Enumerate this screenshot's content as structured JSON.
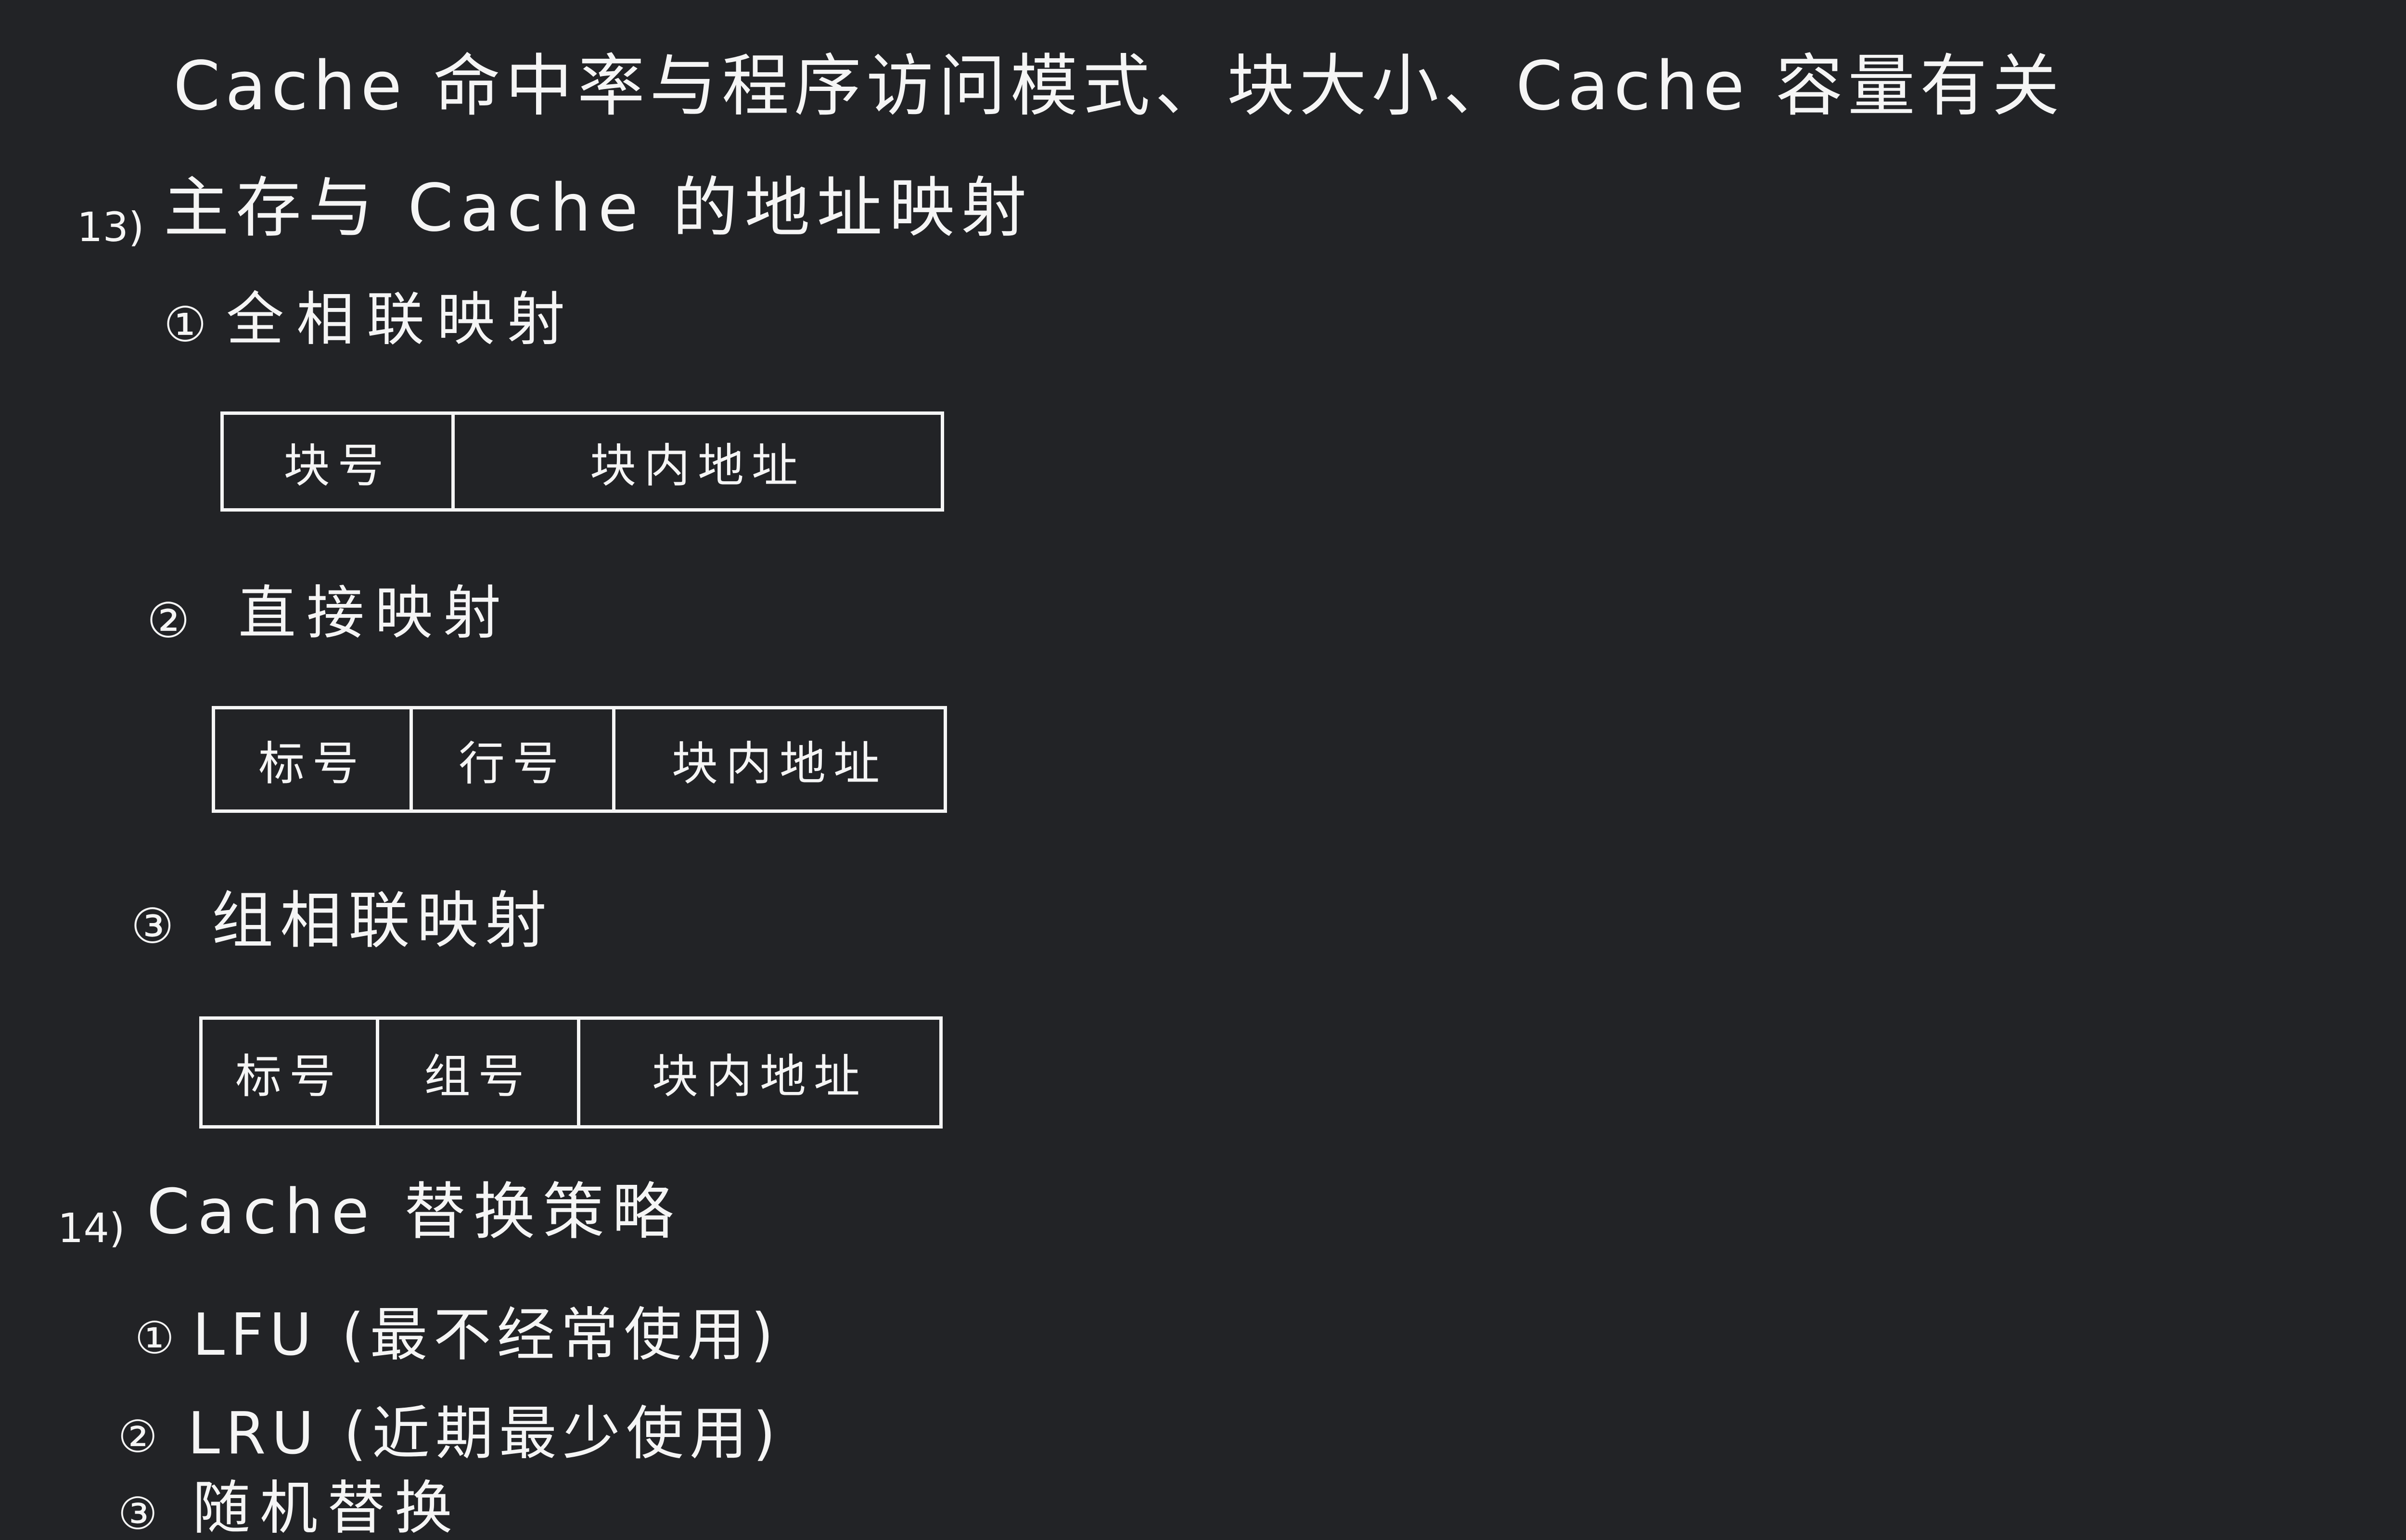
{
  "colors": {
    "background": "#222326",
    "ink": "#f5f5f5"
  },
  "intro": "Cache 命中率与程序访问模式、块大小、Cache 容量有关",
  "section13": {
    "number": "13)",
    "title": "主存与 Cache 的地址映射",
    "items": [
      {
        "marker": "①",
        "title": "全相联映射",
        "fields": [
          "块号",
          "块内地址"
        ]
      },
      {
        "marker": "②",
        "title": "直接映射",
        "fields": [
          "标号",
          "行号",
          "块内地址"
        ]
      },
      {
        "marker": "③",
        "title": "组相联映射",
        "fields": [
          "标号",
          "组号",
          "块内地址"
        ]
      }
    ]
  },
  "section14": {
    "number": "14)",
    "title": "Cache 替换策略",
    "items": [
      {
        "marker": "①",
        "text": "LFU (最不经常使用)"
      },
      {
        "marker": "②",
        "text": "LRU (近期最少使用)"
      },
      {
        "marker": "③",
        "text": "随机替换"
      }
    ]
  }
}
